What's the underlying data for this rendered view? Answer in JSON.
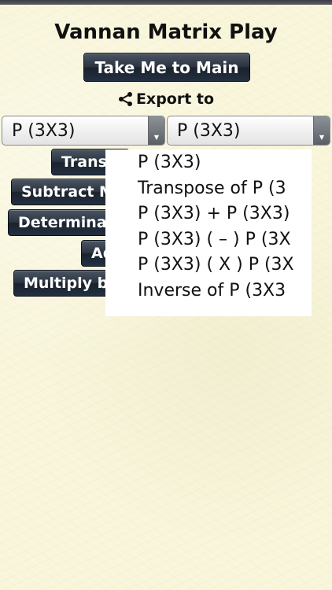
{
  "app": {
    "title": "Vannan Matrix Play"
  },
  "main_button": {
    "label": "Take Me to Main"
  },
  "export": {
    "label": "Export to",
    "icon": "share-icon"
  },
  "selects": {
    "left": {
      "value": "P (3X3)"
    },
    "right": {
      "value": "P (3X3)"
    }
  },
  "operations": [
    "Trans",
    "Subtract M",
    "Determina",
    "Ad",
    "Multiply b"
  ],
  "dropdown": {
    "options": [
      "P (3X3)",
      "Transpose of P (3",
      "P (3X3) + P (3X3)",
      "P (3X3) ( – ) P (3X",
      "P (3X3) ( X ) P (3X",
      "Inverse of P (3X3"
    ]
  }
}
